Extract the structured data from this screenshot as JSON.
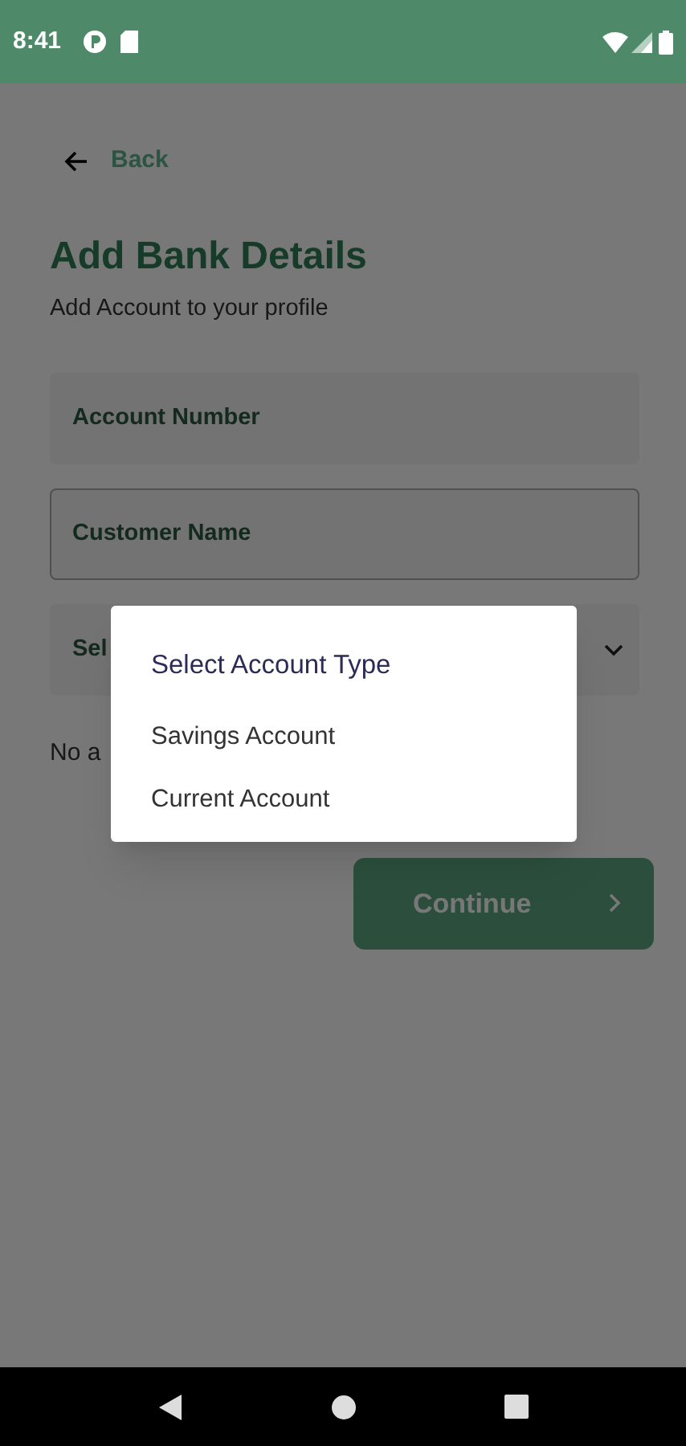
{
  "status_bar": {
    "time": "8:41"
  },
  "back": {
    "label": "Back"
  },
  "title": "Add Bank Details",
  "subtitle": "Add Account to your profile",
  "fields": [
    {
      "kind": "text",
      "placeholder": "Account Number",
      "outlined": false
    },
    {
      "kind": "text",
      "placeholder": "Customer Name",
      "outlined": true
    },
    {
      "kind": "select",
      "placeholder": "Sel",
      "outlined": false
    }
  ],
  "note": "No a",
  "continue_button": {
    "label": "Continue"
  },
  "dialog": {
    "title": "Select Account Type",
    "options": [
      "Savings Account",
      "Current Account"
    ]
  }
}
